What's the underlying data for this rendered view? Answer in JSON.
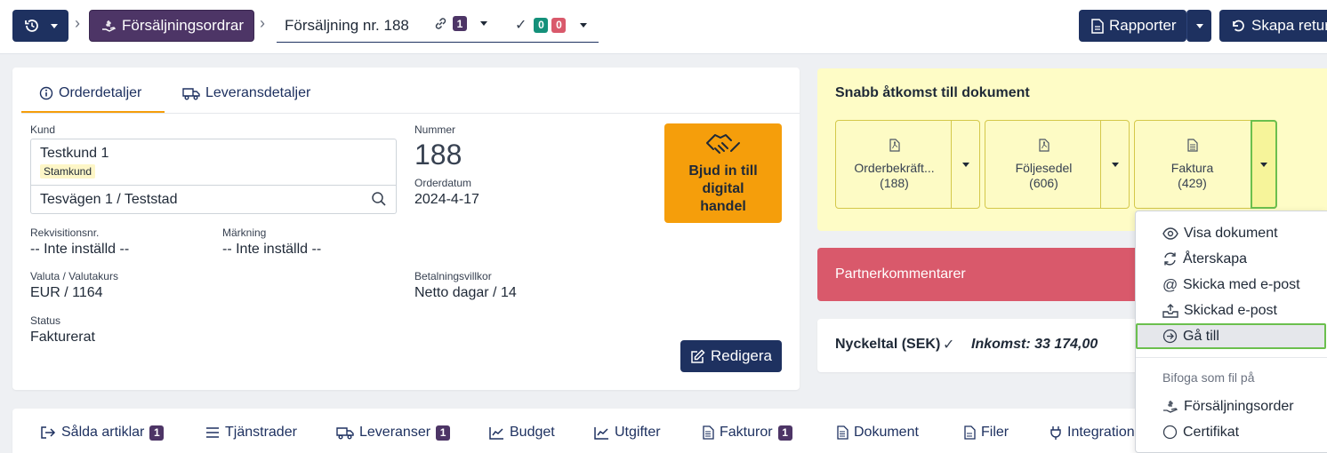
{
  "topbar": {
    "sales_orders_label": "Försäljningsordrar",
    "order_title": "Försäljning nr. 188",
    "links_count": "1",
    "check_green_count": "0",
    "check_red_count": "0",
    "reports_label": "Rapporter",
    "create_return_label": "Skapa retur"
  },
  "tabs": {
    "order_details": "Orderdetaljer",
    "delivery_details": "Leveransdetaljer"
  },
  "order": {
    "customer_label": "Kund",
    "customer_name": "Testkund 1",
    "customer_tag": "Stamkund",
    "address": "Tesvägen 1 / Teststad",
    "number_label": "Nummer",
    "number": "188",
    "order_date_label": "Orderdatum",
    "order_date": "2024-4-17",
    "requisition_label": "Rekvisitionsnr.",
    "requisition_value": "-- Inte inställd --",
    "marking_label": "Märkning",
    "marking_value": "-- Inte inställd --",
    "currency_label": "Valuta / Valutakurs",
    "currency_value": "EUR / 1164",
    "payment_label": "Betalningsvillkor",
    "payment_value": "Netto dagar / 14",
    "status_label": "Status",
    "status_value": "Fakturerat",
    "invite_label": "Bjud in till digital handel",
    "edit_label": "Redigera"
  },
  "quick_access": {
    "title": "Snabb åtkomst till dokument",
    "docs": [
      {
        "name": "Orderbekräft...",
        "count": "(188)"
      },
      {
        "name": "Följesedel",
        "count": "(606)"
      },
      {
        "name": "Faktura",
        "count": "(429)"
      }
    ]
  },
  "partner": {
    "label": "Partnerkommentarer"
  },
  "keyfigures": {
    "label": "Nyckeltal (SEK)",
    "income": "Inkomst: 33 174,00"
  },
  "dropdown": {
    "items": [
      {
        "label": "Visa dokument",
        "icon": "eye-icon"
      },
      {
        "label": "Återskapa",
        "icon": "refresh-icon"
      },
      {
        "label": "Skicka med e-post",
        "icon": "at-icon"
      },
      {
        "label": "Skickad e-post",
        "icon": "inbox-icon"
      },
      {
        "label": "Gå till",
        "icon": "arrow-circle-icon"
      }
    ],
    "section_label": "Bifoga som fil på",
    "attach_items": [
      {
        "label": "Försäljningsorder",
        "icon": "hand-icon"
      },
      {
        "label": "Certifikat",
        "icon": "circle-icon"
      }
    ]
  },
  "bottom_tabs": [
    {
      "label": "Sålda artiklar",
      "badge": "1"
    },
    {
      "label": "Tjänstrader",
      "badge": ""
    },
    {
      "label": "Leveranser",
      "badge": "1"
    },
    {
      "label": "Budget",
      "badge": ""
    },
    {
      "label": "Utgifter",
      "badge": ""
    },
    {
      "label": "Fakturor",
      "badge": "1"
    },
    {
      "label": "Dokument",
      "badge": ""
    },
    {
      "label": "Filer",
      "badge": ""
    },
    {
      "label": "Integration",
      "badge": ""
    }
  ],
  "colors": {
    "navy": "#1e3160",
    "purple": "#4d3566",
    "orange": "#f59e0b",
    "yellow_panel": "#fefcc6",
    "red_panel": "#d9596b",
    "selected_border": "#6bbf4e"
  }
}
